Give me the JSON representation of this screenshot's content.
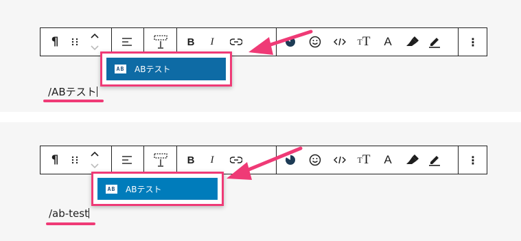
{
  "toolbar_items": [
    "paragraph-icon",
    "drag-handle-icon",
    "move-up-down-icon",
    "align-icon",
    "width-icon",
    "bold-icon",
    "italic-icon",
    "link-icon",
    "color-icon",
    "emoji-icon",
    "code-icon",
    "font-size-icon",
    "text-color-icon",
    "highlighter-icon",
    "marker-icon",
    "more-options-icon"
  ],
  "labels": {
    "bold": "B",
    "italic": "I",
    "font_size_big": "T",
    "font_size_small": "T",
    "text_color": "A",
    "more": "⋮"
  },
  "panel1": {
    "suggestion_label": "ABテスト",
    "icon_text": "AB",
    "typed_text": "/ABテスト"
  },
  "panel2": {
    "suggestion_label": "ABテスト",
    "icon_text": "AB",
    "typed_text": "/ab-test"
  },
  "colors": {
    "accent_pink": "#ef3a76",
    "selected_item_panel1": "#0e6ba5",
    "selected_item_panel2": "#007cbb",
    "border": "#1e1e1e"
  }
}
